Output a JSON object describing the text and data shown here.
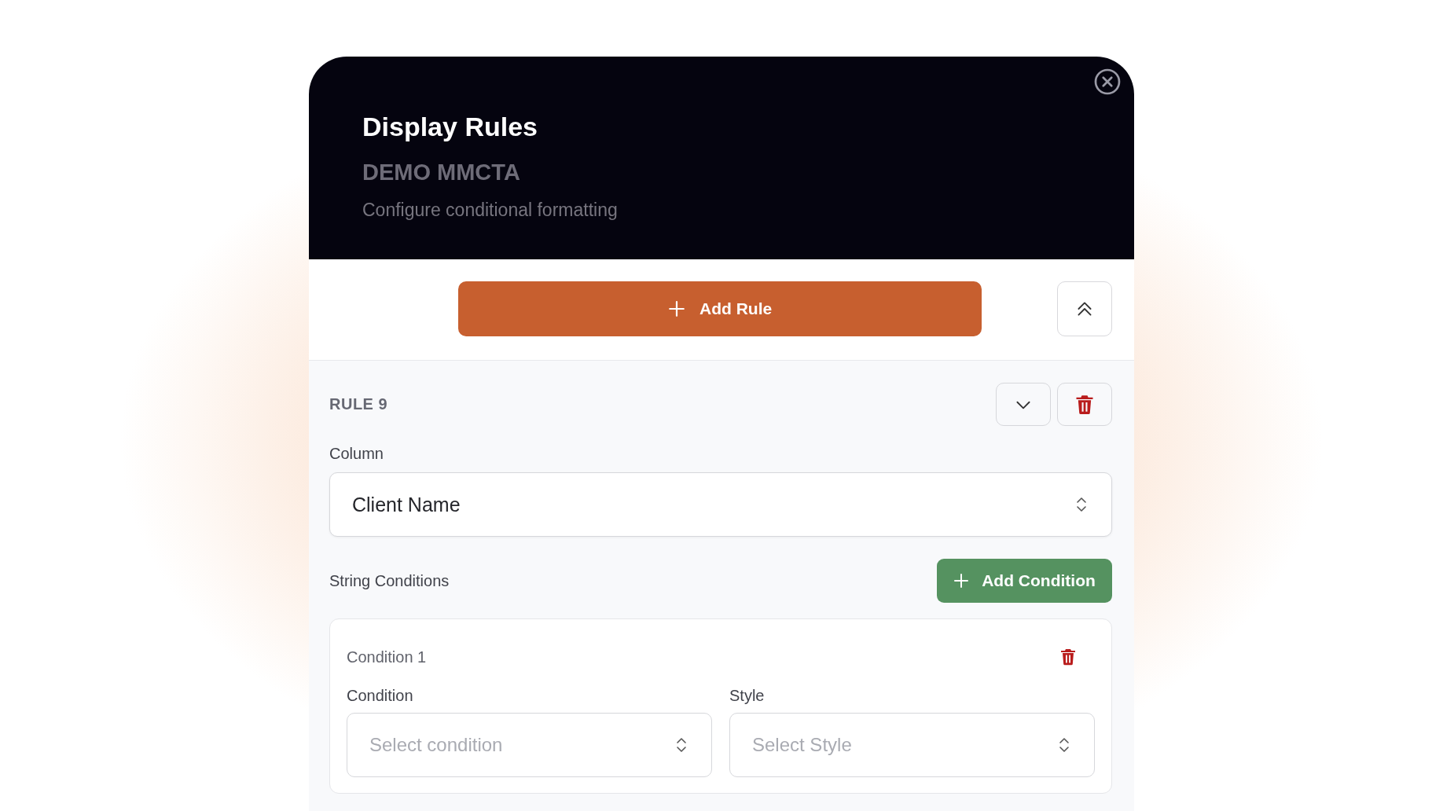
{
  "dialog": {
    "title": "Display Rules",
    "subtitle": "DEMO MMCTA",
    "description": "Configure conditional formatting"
  },
  "add_rule_button": "Add Rule",
  "rule": {
    "title": "RULE 9",
    "column": {
      "label": "Column",
      "value": "Client Name"
    },
    "conditions_label": "String Conditions",
    "add_condition_button": "Add Condition",
    "conditions": [
      {
        "title": "Condition 1",
        "fields": [
          {
            "label": "Condition",
            "placeholder": "Select condition"
          },
          {
            "label": "Style",
            "placeholder": "Select Style"
          }
        ]
      }
    ]
  }
}
